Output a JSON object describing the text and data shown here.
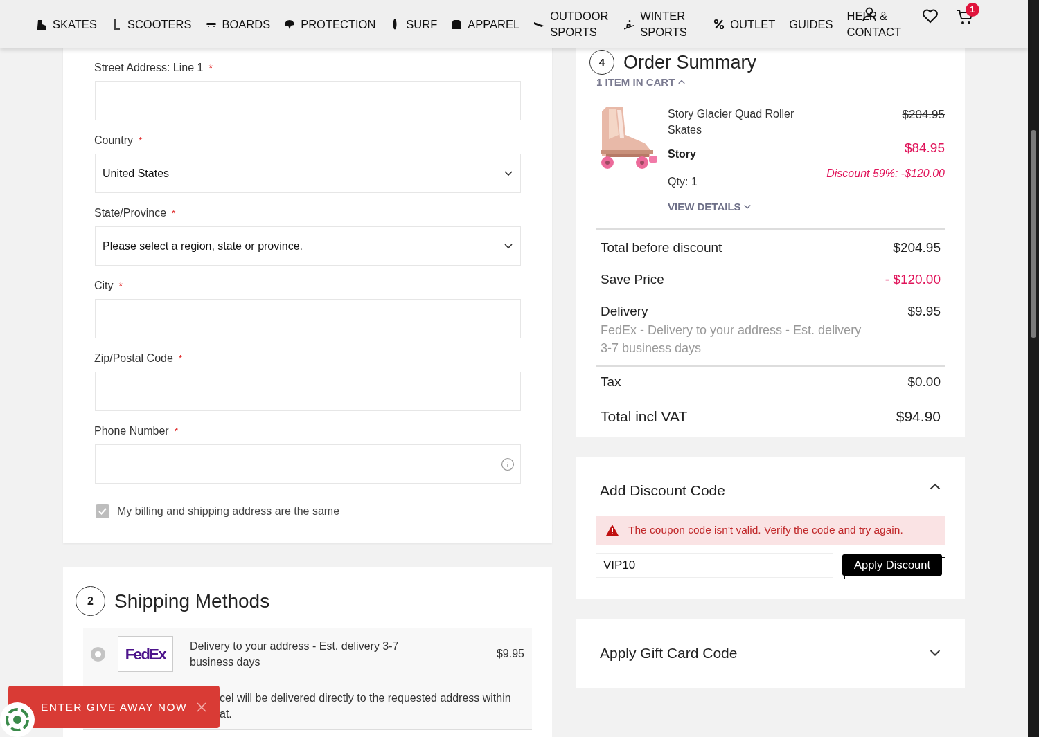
{
  "nav": {
    "items": [
      {
        "label": "SKATES"
      },
      {
        "label": "SCOOTERS"
      },
      {
        "label": "BOARDS"
      },
      {
        "label": "PROTECTION"
      },
      {
        "label": "SURF"
      },
      {
        "label": "APPAREL"
      },
      {
        "label": "OUTDOOR SPORTS"
      },
      {
        "label": "WINTER SPORTS"
      },
      {
        "label": "OUTLET"
      },
      {
        "label": "GUIDES"
      },
      {
        "label": "HELP & CONTACT"
      }
    ],
    "cart_count": "1"
  },
  "address_form": {
    "fields": [
      {
        "label": "Street Address: Line 1",
        "required_mark": "*",
        "kind": "text"
      },
      {
        "label": "Country",
        "required_mark": "*",
        "kind": "select",
        "value": "United States"
      },
      {
        "label": "State/Province",
        "required_mark": "*",
        "kind": "select",
        "value": "Please select a region, state or province."
      },
      {
        "label": "City",
        "required_mark": "*",
        "kind": "text"
      },
      {
        "label": "Zip/Postal Code",
        "required_mark": "*",
        "kind": "text"
      },
      {
        "label": "Phone Number",
        "required_mark": "*",
        "kind": "phone"
      }
    ],
    "same_address": {
      "label": "My billing and shipping address are the same",
      "checked": true
    }
  },
  "shipping": {
    "step": "2",
    "title": "Shipping Methods",
    "methods": [
      {
        "carrier": "FedEx",
        "description": "Delivery to your address - Est. delivery 3-7 business days",
        "price": "$9.95",
        "selected": false,
        "note_lines": [
          "cel will be delivered directly to the requested address within",
          "at."
        ]
      }
    ]
  },
  "order_summary": {
    "step": "4",
    "title": "Order Summary",
    "cart_label": "1 ITEM IN CART",
    "cart_expanded": true,
    "item": {
      "name": "Story Glacier Quad Roller Skates",
      "brand": "Story",
      "qty": "Qty: 1",
      "details": "VIEW DETAILS",
      "old_price": "$204.95",
      "price": "$84.95",
      "discount": "Discount 59%: -$120.00"
    },
    "totals": [
      {
        "label": "Total before discount",
        "value": "$204.95",
        "kind": "plain"
      },
      {
        "label": "Save Price",
        "value": "- $120.00",
        "kind": "saving"
      },
      {
        "label": "Delivery",
        "value": "$9.95",
        "kind": "delivery",
        "detail": "FedEx - Delivery to your address - Est. delivery 3-7 business days"
      },
      {
        "label": "Tax",
        "value": "$0.00",
        "kind": "plain"
      },
      {
        "label": "Total incl VAT",
        "value": "$94.90",
        "kind": "total"
      }
    ]
  },
  "discount": {
    "title": "Add Discount Code",
    "expanded": true,
    "error": "The coupon code isn't valid. Verify the code and try again.",
    "code": "VIP10",
    "button": "Apply Discount"
  },
  "gift_card": {
    "title": "Apply Gift Card Code",
    "expanded": false
  },
  "giveaway": {
    "label": "ENTER GIVE AWAY NOW"
  }
}
